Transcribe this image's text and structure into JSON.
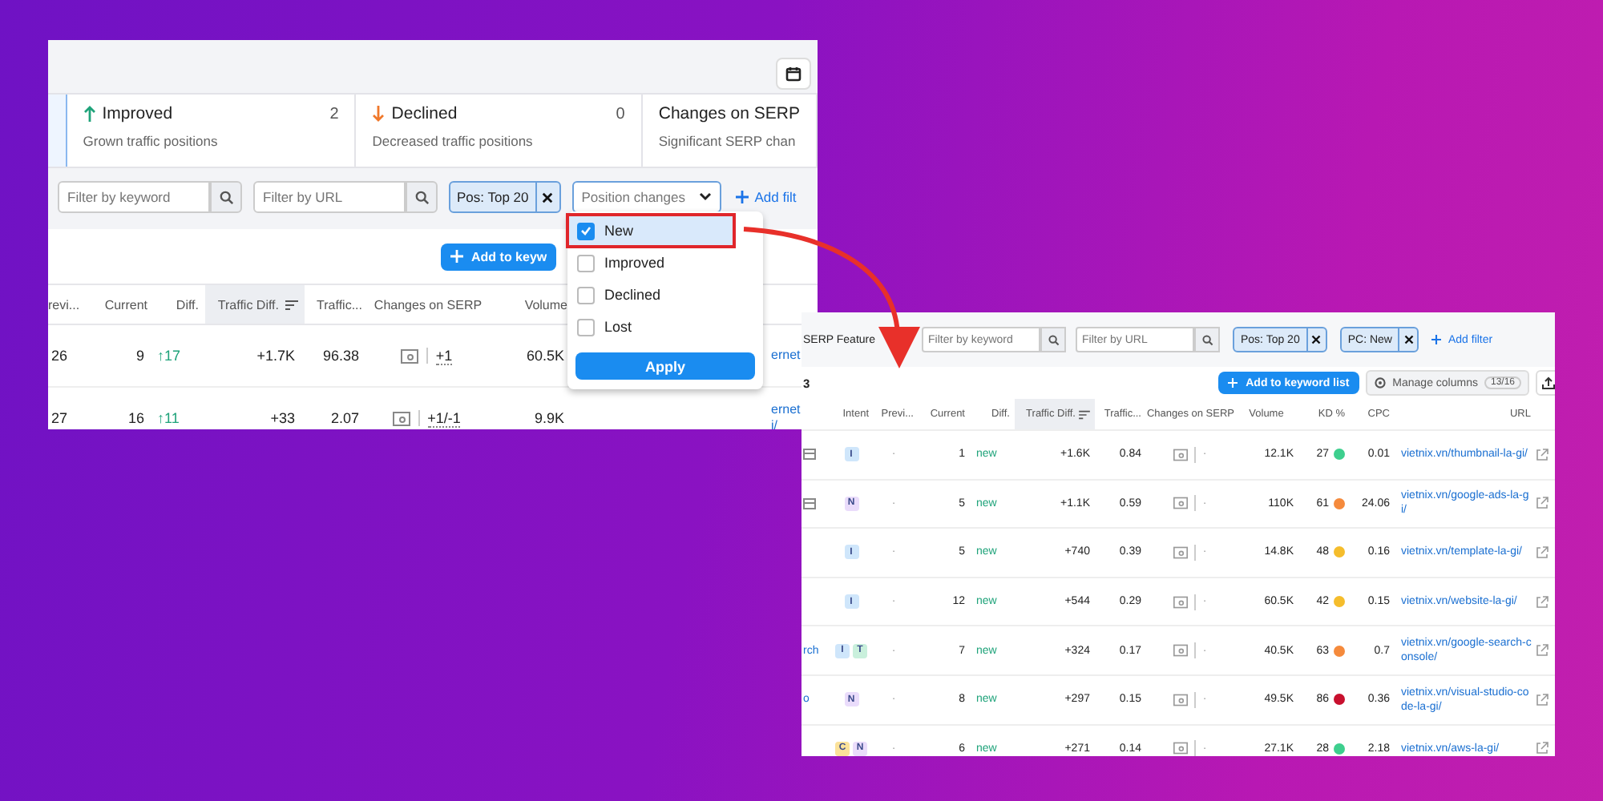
{
  "left_panel": {
    "summary_cards": [
      {
        "kind": "improved",
        "title": "Improved",
        "count": "2",
        "subtitle": "Grown traffic positions"
      },
      {
        "kind": "declined",
        "title": "Declined",
        "count": "0",
        "subtitle": "Decreased traffic positions"
      },
      {
        "kind": "serp",
        "title": "Changes on SERP",
        "subtitle": "Significant SERP chan"
      }
    ],
    "filters": {
      "keyword_placeholder": "Filter by keyword",
      "url_placeholder": "Filter by URL",
      "chips": [
        "Pos: Top 20"
      ],
      "position_select": "Position changes",
      "add_filter": "Add filt"
    },
    "add_button": "Add to keyw",
    "table": {
      "columns": [
        {
          "label": "revi...",
          "sorted": false
        },
        {
          "label": "Current",
          "sorted": false
        },
        {
          "label": "Diff.",
          "sorted": false
        },
        {
          "label": "Traffic Diff.",
          "sorted": true
        },
        {
          "label": "Traffic...",
          "sorted": false
        },
        {
          "label": "Changes on SERP",
          "sorted": false
        },
        {
          "label": "Volume",
          "sorted": false
        }
      ],
      "rows": [
        {
          "previous": "26",
          "current": "9",
          "diff": "↑17",
          "traffic_diff": "+1.7K",
          "traffic": "96.38",
          "serp_change": "+1",
          "volume": "60.5K",
          "url": "ernet"
        },
        {
          "previous": "27",
          "current": "16",
          "diff": "↑11",
          "traffic_diff": "+33",
          "traffic": "2.07",
          "serp_change": "+1/-1",
          "volume": "9.9K",
          "url": "ernet i/"
        }
      ]
    },
    "dropdown": {
      "options": [
        {
          "label": "New",
          "checked": true,
          "highlighted": true
        },
        {
          "label": "Improved",
          "checked": false,
          "highlighted": false
        },
        {
          "label": "Declined",
          "checked": false,
          "highlighted": false
        },
        {
          "label": "Lost",
          "checked": false,
          "highlighted": false
        }
      ],
      "apply": "Apply"
    }
  },
  "right_panel": {
    "filters": {
      "cut_label": "SERP Feature",
      "keyword_placeholder": "Filter by keyword",
      "url_placeholder": "Filter by URL",
      "chips": [
        "Pos: Top 20",
        "PC: New"
      ],
      "add_filter": "Add filter"
    },
    "count": "3",
    "add_button": "Add to keyword list",
    "manage_button": "Manage columns",
    "manage_count": "13/16",
    "table": {
      "columns": [
        {
          "label": "Intent",
          "sorted": false
        },
        {
          "label": "Previ...",
          "sorted": false
        },
        {
          "label": "Current",
          "sorted": false
        },
        {
          "label": "Diff.",
          "sorted": false
        },
        {
          "label": "Traffic Diff.",
          "sorted": true
        },
        {
          "label": "Traffic...",
          "sorted": false
        },
        {
          "label": "Changes on SERP",
          "sorted": false
        },
        {
          "label": "Volume",
          "sorted": false
        },
        {
          "label": "KD %",
          "sorted": false
        },
        {
          "label": "CPC",
          "sorted": false
        },
        {
          "label": "URL",
          "sorted": false
        }
      ],
      "rows": [
        {
          "keyword": "",
          "feature_icon": true,
          "intents": [
            {
              "letter": "I",
              "color": "#cfe6fb"
            }
          ],
          "previous": "·",
          "current": "1",
          "diff": "new",
          "traffic_diff": "+1.6K",
          "traffic": "0.84",
          "serp_change": "·",
          "volume": "12.1K",
          "kd": {
            "value": "27",
            "color": "#3ecf8e"
          },
          "cpc": "0.01",
          "url": "vietnix.vn/thumbnail-la-gi/"
        },
        {
          "keyword": "",
          "feature_icon": true,
          "intents": [
            {
              "letter": "N",
              "color": "#eadcfb"
            }
          ],
          "previous": "·",
          "current": "5",
          "diff": "new",
          "traffic_diff": "+1.1K",
          "traffic": "0.59",
          "serp_change": "·",
          "volume": "110K",
          "kd": {
            "value": "61",
            "color": "#f58a3c"
          },
          "cpc": "24.06",
          "url": "vietnix.vn/google-ads-la-gi/"
        },
        {
          "keyword": "",
          "feature_icon": false,
          "intents": [
            {
              "letter": "I",
              "color": "#cfe6fb"
            }
          ],
          "previous": "·",
          "current": "5",
          "diff": "new",
          "traffic_diff": "+740",
          "traffic": "0.39",
          "serp_change": "·",
          "volume": "14.8K",
          "kd": {
            "value": "48",
            "color": "#f5bd2c"
          },
          "cpc": "0.16",
          "url": "vietnix.vn/template-la-gi/"
        },
        {
          "keyword": "",
          "feature_icon": false,
          "intents": [
            {
              "letter": "I",
              "color": "#cfe6fb"
            }
          ],
          "previous": "·",
          "current": "12",
          "diff": "new",
          "traffic_diff": "+544",
          "traffic": "0.29",
          "serp_change": "·",
          "volume": "60.5K",
          "kd": {
            "value": "42",
            "color": "#f5bd2c"
          },
          "cpc": "0.15",
          "url": "vietnix.vn/website-la-gi/"
        },
        {
          "keyword": "rch",
          "feature_icon": false,
          "intents": [
            {
              "letter": "I",
              "color": "#cfe6fb"
            },
            {
              "letter": "T",
              "color": "#c9f0dc"
            }
          ],
          "previous": "·",
          "current": "7",
          "diff": "new",
          "traffic_diff": "+324",
          "traffic": "0.17",
          "serp_change": "·",
          "volume": "40.5K",
          "kd": {
            "value": "63",
            "color": "#f58a3c"
          },
          "cpc": "0.7",
          "url": "vietnix.vn/google-search-console/"
        },
        {
          "keyword": "o",
          "feature_icon": false,
          "intents": [
            {
              "letter": "N",
              "color": "#eadcfb"
            }
          ],
          "previous": "·",
          "current": "8",
          "diff": "new",
          "traffic_diff": "+297",
          "traffic": "0.15",
          "serp_change": "·",
          "volume": "49.5K",
          "kd": {
            "value": "86",
            "color": "#c8102e"
          },
          "cpc": "0.36",
          "url": "vietnix.vn/visual-studio-code-la-gi/"
        },
        {
          "keyword": "",
          "feature_icon": false,
          "intents": [
            {
              "letter": "C",
              "color": "#fbe29a"
            },
            {
              "letter": "N",
              "color": "#eadcfb"
            }
          ],
          "previous": "·",
          "current": "6",
          "diff": "new",
          "traffic_diff": "+271",
          "traffic": "0.14",
          "serp_change": "·",
          "volume": "27.1K",
          "kd": {
            "value": "28",
            "color": "#3ecf8e"
          },
          "cpc": "2.18",
          "url": "vietnix.vn/aws-la-gi/"
        }
      ]
    }
  }
}
